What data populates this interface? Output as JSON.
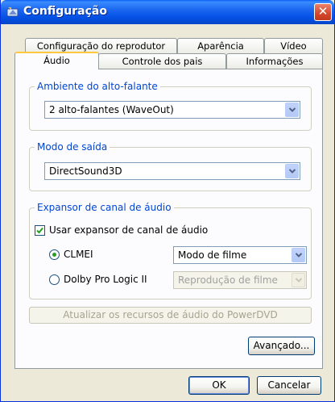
{
  "window": {
    "title": "Configuração"
  },
  "tabs": {
    "row_back": [
      {
        "label": "Configuração do reprodutor"
      },
      {
        "label": "Aparência"
      },
      {
        "label": "Vídeo"
      }
    ],
    "row_front": [
      {
        "label": "Áudio",
        "active": true
      },
      {
        "label": "Controle dos pais"
      },
      {
        "label": "Informações"
      }
    ]
  },
  "speaker_env": {
    "legend": "Ambiente do alto-falante",
    "selected": "2 alto-falantes (WaveOut)"
  },
  "output_mode": {
    "legend": "Modo de saída",
    "selected": "DirectSound3D"
  },
  "channel_expander": {
    "legend": "Expansor de canal de áudio",
    "checkbox_label": "Usar expansor de canal de áudio",
    "checkbox_checked": true,
    "clmei_label": "CLMEI",
    "clmei_selected": true,
    "clmei_mode": "Modo de filme",
    "dolby_label": "Dolby Pro Logic II",
    "dolby_selected": false,
    "dolby_mode": "Reprodução de filme"
  },
  "buttons": {
    "update": "Atualizar os recursos de áudio do PowerDVD",
    "advanced": "Avançado...",
    "ok": "OK",
    "cancel": "Cancelar"
  },
  "colors": {
    "titlebar": "#0552e6",
    "legend_text": "#0046d5",
    "active_tab_highlight": "#ffc83c",
    "radio_dot": "#21a121"
  }
}
